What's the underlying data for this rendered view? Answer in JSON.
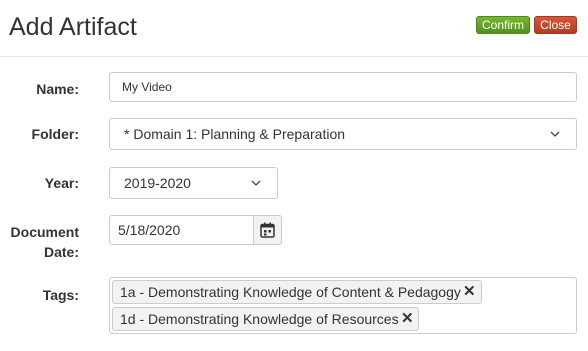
{
  "dialog": {
    "title": "Add Artifact",
    "confirm_label": "Confirm",
    "close_label": "Close"
  },
  "form": {
    "name": {
      "label": "Name:",
      "value": "My Video"
    },
    "folder": {
      "label": "Folder:",
      "value": "* Domain 1: Planning & Preparation"
    },
    "year": {
      "label": "Year:",
      "value": "2019-2020"
    },
    "document_date": {
      "label_line1": "Document",
      "label_line2": "Date:",
      "value": "5/18/2020"
    },
    "tags": {
      "label": "Tags:",
      "items": [
        {
          "label": "1a - Demonstrating Knowledge of Content & Pedagogy",
          "remove": "✕"
        },
        {
          "label": "1d - Demonstrating Knowledge of Resources",
          "remove": "✕"
        }
      ]
    }
  },
  "colors": {
    "confirm": "#5a9e1f",
    "close": "#c0462a",
    "border": "#cccccc"
  },
  "icons": {
    "calendar": "calendar-icon",
    "chevron": "chevron-down-icon",
    "remove": "close-icon"
  }
}
